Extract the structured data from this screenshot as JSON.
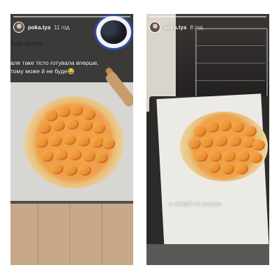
{
  "stories": [
    {
      "username": "poka.tya",
      "time": "11 год",
      "caption_lines": [
        "буде галета",
        "але таке тісто готувала вперше,",
        "тому може й не буде😂"
      ]
    },
    {
      "username": "poka.tya",
      "time": "8 год",
      "caption_lines": [
        "а лЮдЮ не вирішо"
      ]
    }
  ],
  "colors": {
    "background": "#ffffff",
    "apricot": "#f0a04a",
    "crust": "#f1d49c",
    "bowl_blue": "#2f4f9a"
  },
  "icons": [
    "avatar"
  ]
}
